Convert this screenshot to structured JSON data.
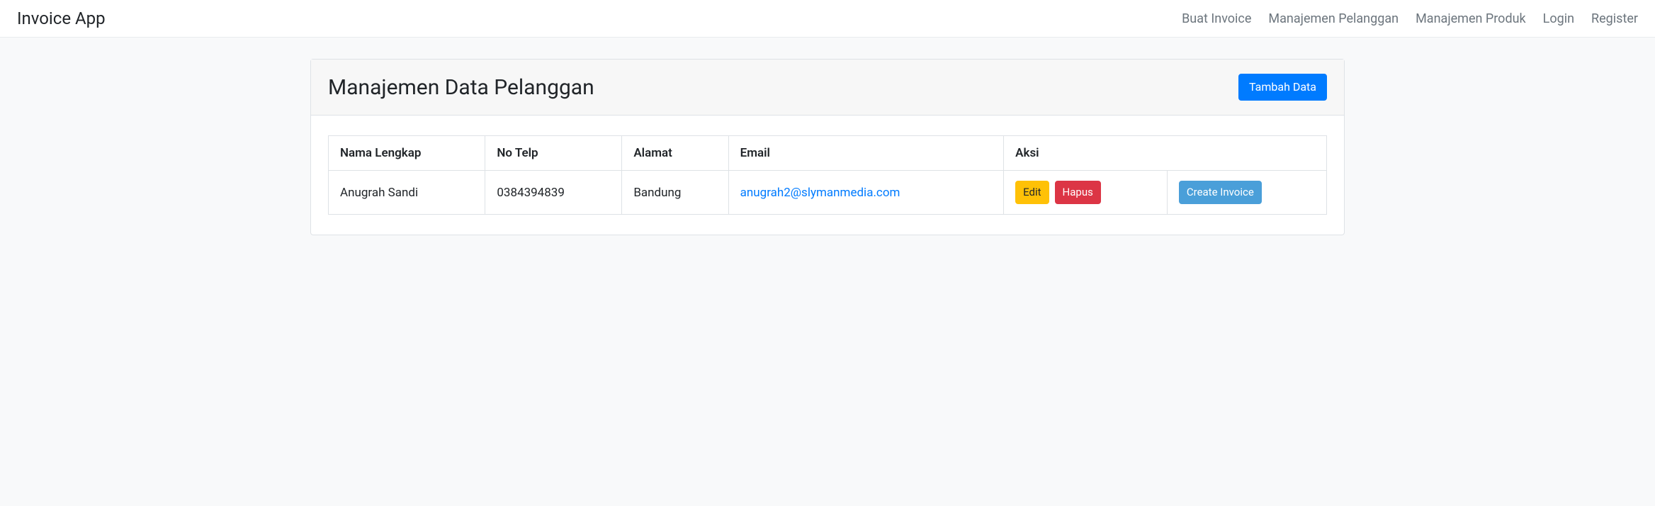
{
  "navbar": {
    "brand": "Invoice App",
    "links": [
      "Buat Invoice",
      "Manajemen Pelanggan",
      "Manajemen Produk",
      "Login",
      "Register"
    ]
  },
  "page": {
    "title": "Manajemen Data Pelanggan",
    "add_button": "Tambah Data"
  },
  "table": {
    "headers": {
      "name": "Nama Lengkap",
      "phone": "No Telp",
      "address": "Alamat",
      "email": "Email",
      "action": "Aksi"
    },
    "rows": [
      {
        "name": "Anugrah Sandi",
        "phone": "0384394839",
        "address": "Bandung",
        "email": "anugrah2@slymanmedia.com"
      }
    ],
    "actions": {
      "edit": "Edit",
      "delete": "Hapus",
      "create_invoice": "Create Invoice"
    }
  }
}
